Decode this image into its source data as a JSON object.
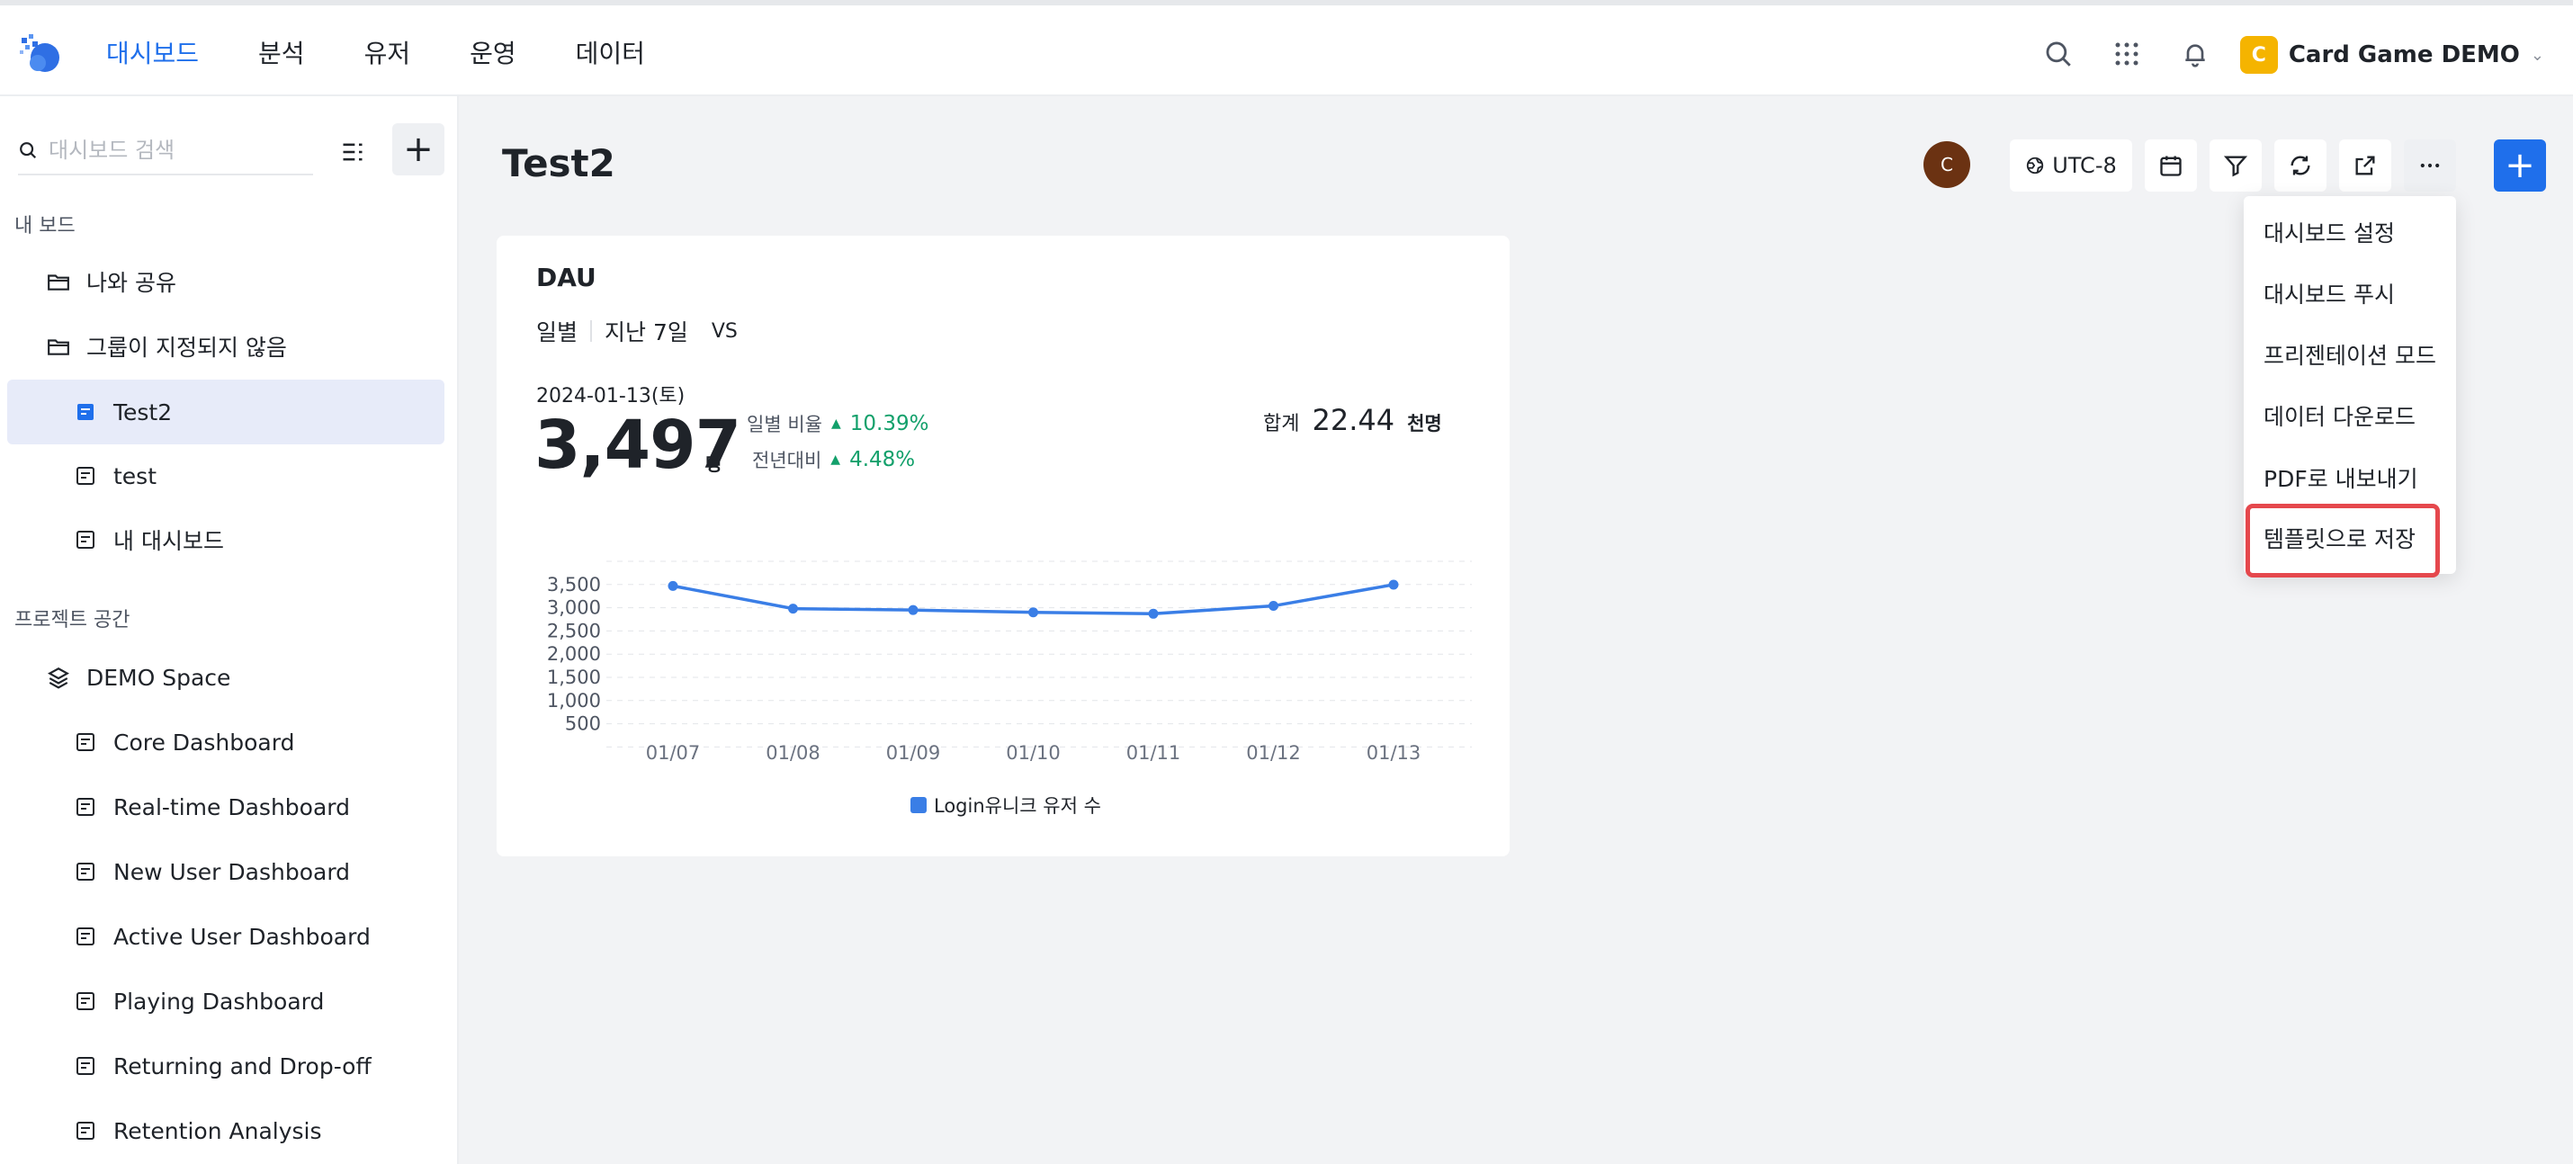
{
  "nav": {
    "items": [
      "대시보드",
      "분석",
      "유저",
      "운영",
      "데이터"
    ],
    "active_index": 0
  },
  "org": {
    "badge": "C",
    "name": "Card Game DEMO"
  },
  "sidebar": {
    "search_placeholder": "대시보드 검색",
    "section_mine": "내 보드",
    "section_project": "프로젝트 공간",
    "mine_items": [
      {
        "label": "나와 공유",
        "icon": "folder-icon"
      },
      {
        "label": "그룹이 지정되지 않음",
        "icon": "folder-icon"
      },
      {
        "label": "Test2",
        "icon": "dashboard-icon",
        "selected": true
      },
      {
        "label": "test",
        "icon": "dashboard-icon"
      },
      {
        "label": "내 대시보드",
        "icon": "dashboard-icon"
      }
    ],
    "space": {
      "label": "DEMO Space",
      "icon": "layers-icon"
    },
    "project_items": [
      "Core Dashboard",
      "Real-time Dashboard",
      "New User Dashboard",
      "Active User Dashboard",
      "Playing Dashboard",
      "Returning and Drop-off",
      "Retention Analysis"
    ]
  },
  "page": {
    "title": "Test2",
    "avatar": "C",
    "timezone": "UTC-8"
  },
  "menu": {
    "items": [
      "대시보드 설정",
      "대시보드 푸시",
      "프리젠테이션 모드",
      "데이터 다운로드",
      "PDF로 내보내기",
      "템플릿으로 저장"
    ],
    "highlighted_index": 5
  },
  "card": {
    "title": "DAU",
    "granularity": "일별",
    "range": "지난 7일",
    "vs": "VS",
    "date": "2024-01-13(토)",
    "value": "3,497",
    "value_unit": "명",
    "daily_label": "일별 비율",
    "daily_value": "10.39%",
    "yoy_label": "전년대비",
    "yoy_value": "4.48%",
    "total_label": "합계",
    "total_value": "22.44",
    "total_unit": "천명",
    "accent": "#3a7ee6",
    "up_color": "#13a06b"
  },
  "chart_data": {
    "type": "line",
    "categories": [
      "01/07",
      "01/08",
      "01/09",
      "01/10",
      "01/11",
      "01/12",
      "01/13"
    ],
    "series": [
      {
        "name": "Login유니크 유저 수",
        "values": [
          3470,
          2980,
          2950,
          2900,
          2870,
          3040,
          3497
        ]
      }
    ],
    "y_ticks": [
      "3,500",
      "3,000",
      "2,500",
      "2,000",
      "1,500",
      "1,000",
      "500"
    ],
    "ylim": [
      0,
      4000
    ],
    "grid": true,
    "legend": "bottom"
  }
}
